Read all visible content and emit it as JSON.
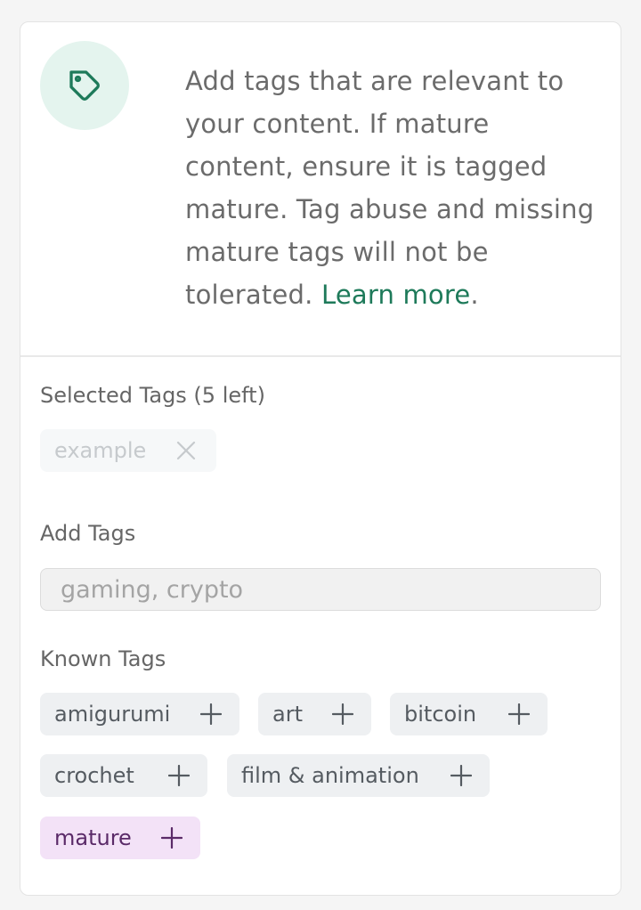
{
  "info": {
    "text": "Add tags that are relevant to your content. If mature content, ensure it is tagged mature. Tag abuse and missing mature tags will not be tolerated.",
    "link_label": "Learn more",
    "link_suffix": "."
  },
  "selected": {
    "heading": "Selected Tags (5 left)",
    "chips": [
      {
        "label": "example"
      }
    ]
  },
  "add": {
    "heading": "Add Tags",
    "placeholder": "gaming, crypto"
  },
  "known": {
    "heading": "Known Tags",
    "chips": [
      {
        "label": "amigurumi"
      },
      {
        "label": "art"
      },
      {
        "label": "bitcoin"
      },
      {
        "label": "crochet"
      },
      {
        "label": "film & animation"
      },
      {
        "label": "mature"
      }
    ]
  },
  "colors": {
    "accent": "#1e7a5a",
    "icon_bg": "#e4f4ee",
    "chip_bg": "#eef0f2",
    "mature_bg": "#f3e2f7"
  },
  "icons": {
    "info": "tag-icon",
    "add": "plus-icon",
    "remove": "close-icon"
  }
}
